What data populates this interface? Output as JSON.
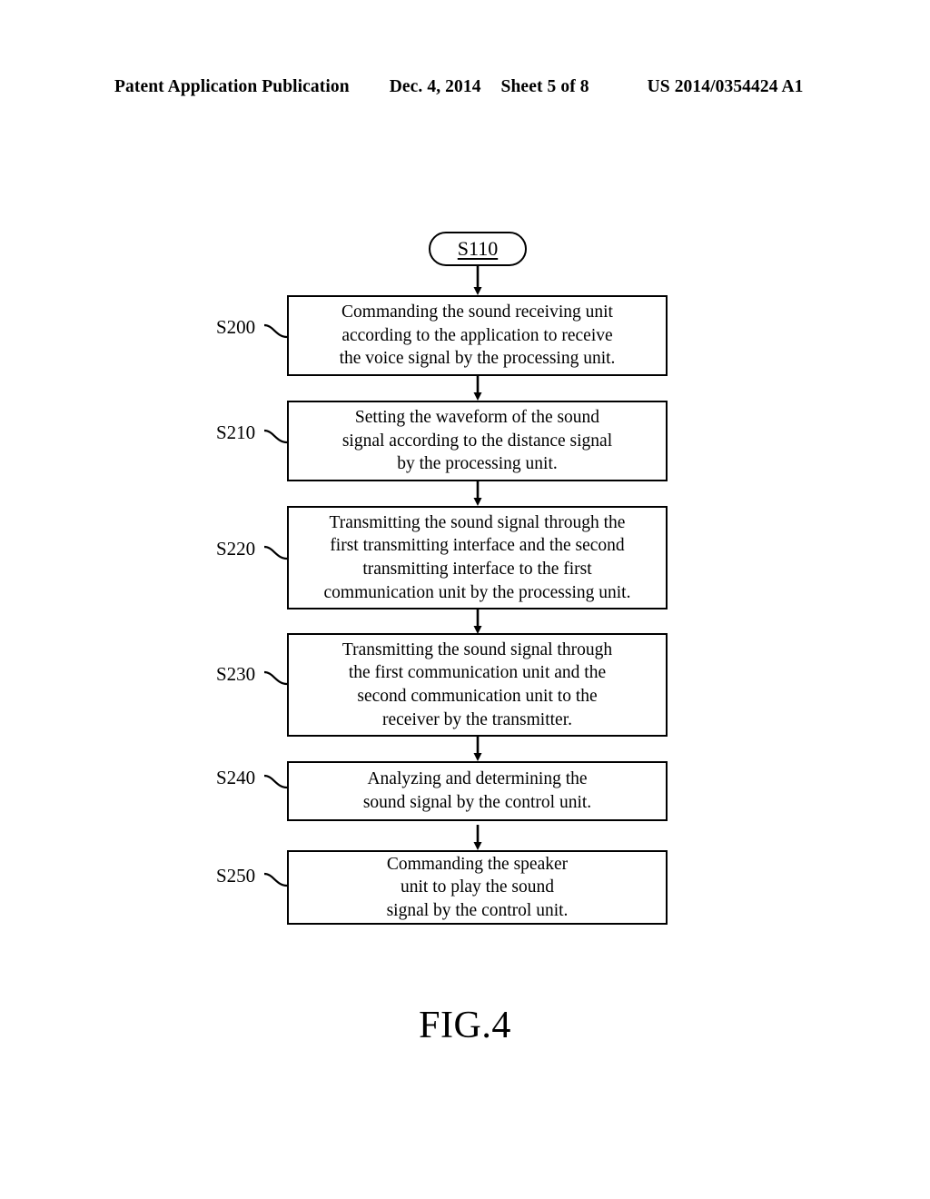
{
  "header": {
    "publication": "Patent Application Publication",
    "date": "Dec. 4, 2014",
    "sheet": "Sheet 5 of 8",
    "patent_number": "US 2014/0354424 A1"
  },
  "figure": {
    "caption": "FIG.4",
    "type": "flowchart",
    "start_node": {
      "label": "S110"
    },
    "steps": [
      {
        "ref": "S200",
        "lines": [
          "Commanding the sound receiving unit",
          "according to the application to receive",
          "the voice signal by the processing unit."
        ]
      },
      {
        "ref": "S210",
        "lines": [
          "Setting the waveform of the sound",
          "signal according to the distance signal",
          "by the processing unit."
        ]
      },
      {
        "ref": "S220",
        "lines": [
          "Transmitting the sound signal through the",
          "first transmitting interface and the second",
          "transmitting interface to the first",
          "communication unit by the processing unit."
        ]
      },
      {
        "ref": "S230",
        "lines": [
          "Transmitting the sound signal through",
          "the first communication unit and the",
          "second communication unit to the",
          "receiver by the transmitter."
        ]
      },
      {
        "ref": "S240",
        "lines": [
          "Analyzing and determining the",
          "sound signal by the control unit."
        ]
      },
      {
        "ref": "S250",
        "lines": [
          "Commanding the speaker",
          "unit to play the sound",
          "signal by the control unit."
        ]
      }
    ]
  },
  "colors": {
    "ink": "#000000",
    "paper": "#ffffff"
  }
}
